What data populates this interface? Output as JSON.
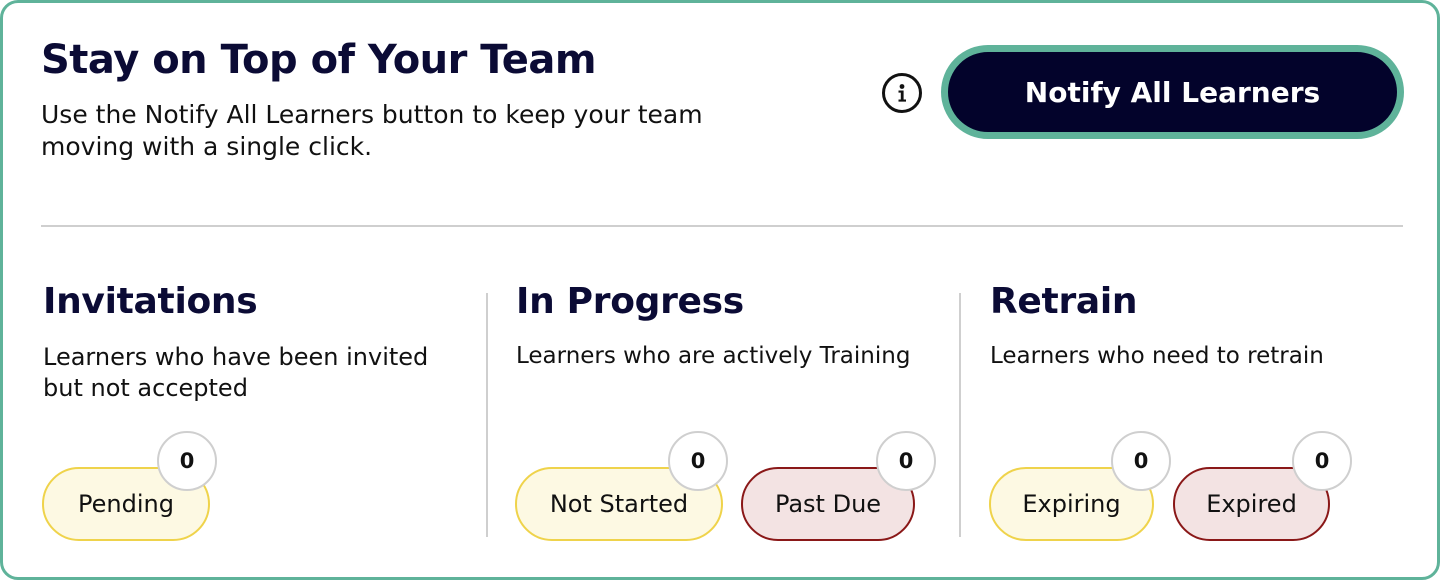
{
  "header": {
    "title": "Stay on Top of Your Team",
    "subtitle": "Use the Notify All Learners button to keep your team moving with a single click.",
    "notify_button_label": "Notify All Learners",
    "info_icon": "info-icon"
  },
  "sections": [
    {
      "title": "Invitations",
      "description": "Learners who have been invited but not accepted",
      "statuses": [
        {
          "label": "Pending",
          "count": "0",
          "tone": "yellow"
        }
      ]
    },
    {
      "title": "In Progress",
      "description": "Learners who are actively Training",
      "statuses": [
        {
          "label": "Not Started",
          "count": "0",
          "tone": "yellow"
        },
        {
          "label": "Past Due",
          "count": "0",
          "tone": "red"
        }
      ]
    },
    {
      "title": "Retrain",
      "description": "Learners who need to retrain",
      "statuses": [
        {
          "label": "Expiring",
          "count": "0",
          "tone": "yellow"
        },
        {
          "label": "Expired",
          "count": "0",
          "tone": "red"
        }
      ]
    }
  ],
  "colors": {
    "accent": "#5fb39a",
    "navy": "#03032b",
    "yellow_border": "#efd34b",
    "yellow_fill": "#fdf9e3",
    "red_border": "#8a1818",
    "red_fill": "#f3e3e3"
  }
}
